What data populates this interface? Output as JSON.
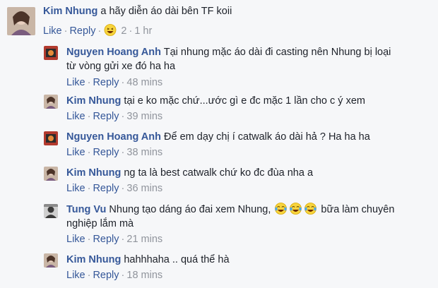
{
  "comments": [
    {
      "name": "Kim Nhung",
      "text": "a hãy diễn áo dài bên TF koii",
      "like": "Like",
      "reply": "Reply",
      "reaction_count": "2",
      "time": "1 hr",
      "avatar_color": "#8a6a5a"
    },
    {
      "name": "Nguyen Hoang Anh",
      "text_line1": "Tại nhung mặc áo dài đi casting nên Nhung bị loại",
      "text_line2": "từ vòng gửi xe đó ha ha",
      "like": "Like",
      "reply": "Reply",
      "time": "48 mins",
      "avatar_color": "#b23a2e"
    },
    {
      "name": "Kim Nhung",
      "text": "tại e ko mặc chứ...ước gì e đc mặc 1 lần cho c ý xem",
      "like": "Like",
      "reply": "Reply",
      "time": "39 mins",
      "avatar_color": "#8a6a5a"
    },
    {
      "name": "Nguyen Hoang Anh",
      "text": "Để em dạy chị í catwalk áo dài hả ? Ha ha ha",
      "like": "Like",
      "reply": "Reply",
      "time": "38 mins",
      "avatar_color": "#b23a2e"
    },
    {
      "name": "Kim Nhung",
      "text": "ng ta là best catwalk chứ ko đc đùa nha a",
      "like": "Like",
      "reply": "Reply",
      "time": "36 mins",
      "avatar_color": "#8a6a5a"
    },
    {
      "name": "Tung Vu",
      "text_before_emoji": "Nhung tạo dáng áo đai xem Nhung,",
      "text_after_emoji": "bữa làm chuyên",
      "text_line2": "nghiệp lắm mà",
      "like": "Like",
      "reply": "Reply",
      "time": "21 mins",
      "avatar_color": "#3a3a3a"
    },
    {
      "name": "Kim Nhung",
      "text": "hahhhaha .. quá thể hà",
      "like": "Like",
      "reply": "Reply",
      "time": "18 mins",
      "avatar_color": "#8a6a5a"
    }
  ],
  "icons": {
    "reaction": "laughing-emoji-icon",
    "tears_of_joy": "tears-of-joy-emoji-icon"
  }
}
